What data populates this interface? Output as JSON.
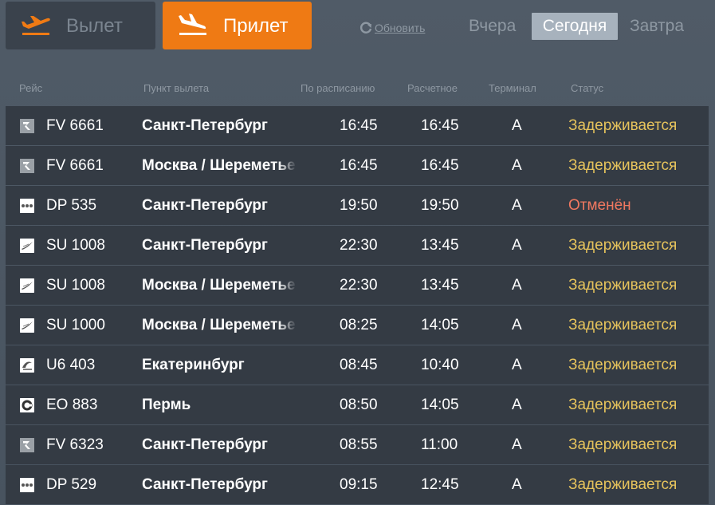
{
  "tabs": {
    "departure_label": "Вылет",
    "arrival_label": "Прилет"
  },
  "toolbar": {
    "refresh_label": "Обновить",
    "yesterday_label": "Вчера",
    "today_label": "Сегодня",
    "tomorrow_label": "Завтра"
  },
  "colors": {
    "accent": "#ef7a14",
    "delayed": "#e6c35c",
    "cancelled": "#f07860"
  },
  "table": {
    "headers": {
      "flight": "Рейс",
      "origin": "Пункт вылета",
      "scheduled": "По расписанию",
      "estimated": "Расчетное",
      "terminal": "Терминал",
      "status": "Статус"
    },
    "rows": [
      {
        "logo": "rossiya-logo-icon",
        "flight": "FV 6661",
        "origin": "Санкт-Петербург",
        "scheduled": "16:45",
        "estimated": "16:45",
        "terminal": "A",
        "status": "Задерживается",
        "status_kind": "delayed"
      },
      {
        "logo": "rossiya-logo-icon",
        "flight": "FV 6661",
        "origin": "Москва / Шереметьево",
        "scheduled": "16:45",
        "estimated": "16:45",
        "terminal": "A",
        "status": "Задерживается",
        "status_kind": "delayed"
      },
      {
        "logo": "pobeda-logo-icon",
        "flight": "DP 535",
        "origin": "Санкт-Петербург",
        "scheduled": "19:50",
        "estimated": "19:50",
        "terminal": "A",
        "status": "Отменён",
        "status_kind": "cancelled"
      },
      {
        "logo": "aeroflot-logo-icon",
        "flight": "SU 1008",
        "origin": "Санкт-Петербург",
        "scheduled": "22:30",
        "estimated": "13:45",
        "terminal": "A",
        "status": "Задерживается",
        "status_kind": "delayed"
      },
      {
        "logo": "aeroflot-logo-icon",
        "flight": "SU 1008",
        "origin": "Москва / Шереметьево",
        "scheduled": "22:30",
        "estimated": "13:45",
        "terminal": "A",
        "status": "Задерживается",
        "status_kind": "delayed"
      },
      {
        "logo": "aeroflot-logo-icon",
        "flight": "SU 1000",
        "origin": "Москва / Шереметьево",
        "scheduled": "08:25",
        "estimated": "14:05",
        "terminal": "A",
        "status": "Задерживается",
        "status_kind": "delayed"
      },
      {
        "logo": "ural-logo-icon",
        "flight": "U6 403",
        "origin": "Екатеринбург",
        "scheduled": "08:45",
        "estimated": "10:40",
        "terminal": "A",
        "status": "Задерживается",
        "status_kind": "delayed"
      },
      {
        "logo": "pegas-logo-icon",
        "flight": "EO 883",
        "origin": "Пермь",
        "scheduled": "08:50",
        "estimated": "14:05",
        "terminal": "A",
        "status": "Задерживается",
        "status_kind": "delayed"
      },
      {
        "logo": "rossiya-logo-icon",
        "flight": "FV 6323",
        "origin": "Санкт-Петербург",
        "scheduled": "08:55",
        "estimated": "11:00",
        "terminal": "A",
        "status": "Задерживается",
        "status_kind": "delayed"
      },
      {
        "logo": "pobeda-logo-icon",
        "flight": "DP 529",
        "origin": "Санкт-Петербург",
        "scheduled": "09:15",
        "estimated": "12:45",
        "terminal": "A",
        "status": "Задерживается",
        "status_kind": "delayed"
      }
    ]
  }
}
